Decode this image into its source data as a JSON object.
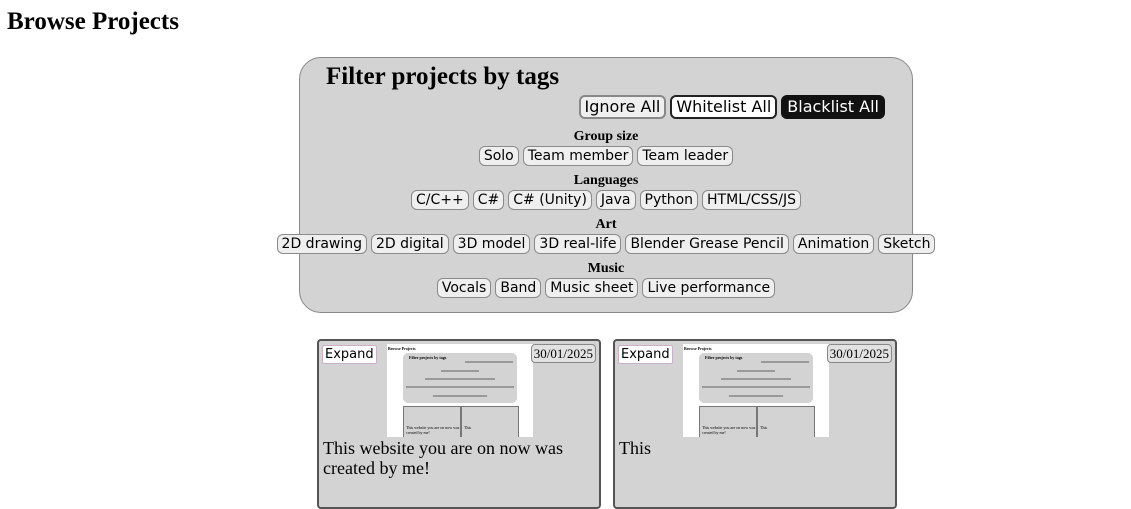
{
  "page": {
    "title": "Browse Projects"
  },
  "filter": {
    "title": "Filter projects by tags",
    "modes": [
      "Ignore All",
      "Whitelist All",
      "Blacklist All"
    ],
    "groups": [
      {
        "name": "Group size",
        "tags": [
          "Solo",
          "Team member",
          "Team leader"
        ]
      },
      {
        "name": "Languages",
        "tags": [
          "C/C++",
          "C#",
          "C# (Unity)",
          "Java",
          "Python",
          "HTML/CSS/JS"
        ]
      },
      {
        "name": "Art",
        "tags": [
          "2D drawing",
          "2D digital",
          "3D model",
          "3D real-life",
          "Blender Grease Pencil",
          "Animation",
          "Sketch"
        ]
      },
      {
        "name": "Music",
        "tags": [
          "Vocals",
          "Band",
          "Music sheet",
          "Live performance"
        ]
      }
    ]
  },
  "projects": [
    {
      "expand_label": "Expand",
      "date": "30/01/2025",
      "description": "This website you are on now was created by me!"
    },
    {
      "expand_label": "Expand",
      "date": "30/01/2025",
      "description": "This"
    }
  ],
  "colors": {
    "panel": "#d3d3d3",
    "blacklist": "#111111",
    "card_border": "#555555"
  }
}
